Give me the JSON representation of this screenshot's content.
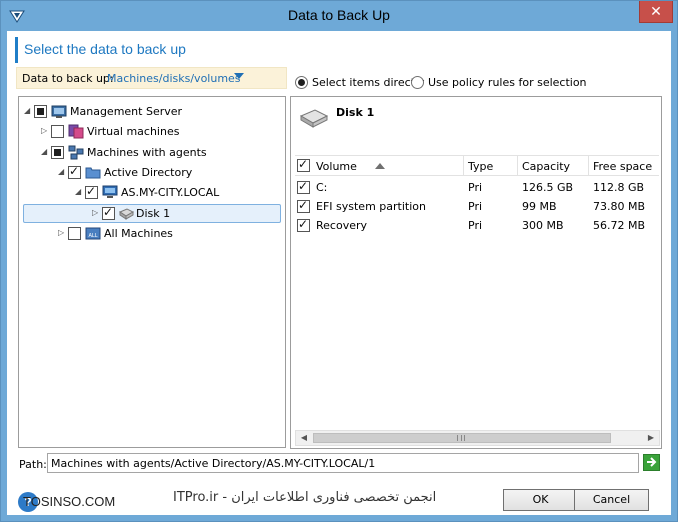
{
  "window": {
    "title": "Data to Back Up",
    "close_glyph": "✕"
  },
  "header": {
    "title": "Select the data to back up"
  },
  "scope": {
    "label": "Data to back up:",
    "value": "Machines/disks/volumes"
  },
  "selection_mode": {
    "options": [
      "Select items directly",
      "Use policy rules for selection"
    ],
    "selected": "Select items directly"
  },
  "tree": [
    {
      "label": "Management Server",
      "state": "partial",
      "expanded": true,
      "icon": "management-server-icon"
    },
    {
      "label": "Virtual machines",
      "state": "unchecked",
      "expanded": false,
      "icon": "virtual-machines-icon"
    },
    {
      "label": "Machines with agents",
      "state": "partial",
      "expanded": true,
      "icon": "machines-with-agents-icon"
    },
    {
      "label": "Active Directory",
      "state": "checked",
      "expanded": true,
      "icon": "folder-icon"
    },
    {
      "label": "AS.MY-CITY.LOCAL",
      "state": "checked",
      "expanded": true,
      "icon": "computer-icon"
    },
    {
      "label": "Disk 1",
      "state": "checked",
      "expanded": false,
      "icon": "disk-icon",
      "selected": true
    },
    {
      "label": "All Machines",
      "state": "unchecked",
      "expanded": false,
      "icon": "all-machines-icon"
    }
  ],
  "disk_panel": {
    "title": "Disk 1",
    "columns": [
      "Volume",
      "Type",
      "Capacity",
      "Free space"
    ],
    "rows": [
      {
        "volume": "C:",
        "type": "Pri",
        "capacity": "126.5 GB",
        "free": "112.8 GB",
        "checked": true
      },
      {
        "volume": "EFI system partition",
        "type": "Pri",
        "capacity": "99 MB",
        "free": "73.80 MB",
        "checked": true
      },
      {
        "volume": "Recovery",
        "type": "Pri",
        "capacity": "300 MB",
        "free": "56.72 MB",
        "checked": true
      }
    ]
  },
  "path": {
    "label": "Path:",
    "value": "Machines with agents/Active Directory/AS.MY-CITY.LOCAL/1"
  },
  "footer": {
    "help_glyph": "?",
    "ok_label": "OK",
    "cancel_label": "Cancel",
    "watermark_left": "TOSINSO.COM",
    "watermark_right": "انجمن تخصصی فناوری اطلاعات ایران - ITPro.ir"
  },
  "colors": {
    "title_bar": "#6ea9d7",
    "accent": "#1d78c1",
    "close_button": "#c7504a",
    "selection": "#e5f0fb"
  }
}
